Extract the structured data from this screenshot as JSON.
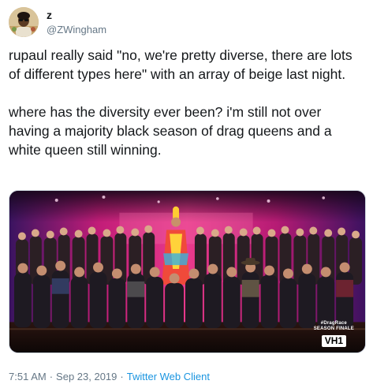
{
  "user": {
    "display_name": "z",
    "handle": "@ZWingham"
  },
  "tweet": {
    "paragraphs": [
      "rupaul really said \"no, we're pretty diverse, there are lots of different types here\" with an array of beige last night.",
      "where has the diversity ever been? i'm still not over having a majority black season of drag queens and a white queen still winning."
    ]
  },
  "media": {
    "watermark_hashtag": "#DragRace",
    "watermark_event": "SEASON FINALE",
    "watermark_logo": "VH1"
  },
  "footer": {
    "time": "7:51 AM",
    "separator": "·",
    "date": "Sep 23, 2019",
    "source": "Twitter Web Client"
  },
  "colors": {
    "text": "#14171a",
    "secondary": "#657786",
    "link": "#1b95e0",
    "stage_pink": "#e0247a",
    "stage_purple": "#5a1e8c"
  },
  "icons": {
    "avatar": "profile-photo"
  }
}
